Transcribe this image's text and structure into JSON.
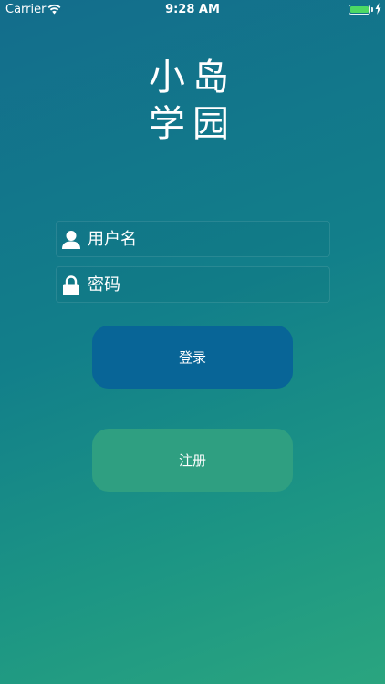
{
  "status_bar": {
    "carrier": "Carrier",
    "time": "9:28 AM",
    "battery_color": "#4cd964"
  },
  "logo": {
    "line1": "小岛",
    "line2": "学园"
  },
  "form": {
    "username": {
      "placeholder": "用户名",
      "value": "",
      "icon": "person-icon"
    },
    "password": {
      "placeholder": "密码",
      "value": "",
      "icon": "lock-icon"
    }
  },
  "buttons": {
    "login_label": "登录",
    "login_color": "#086597",
    "register_label": "注册",
    "register_color": "#2f9f81"
  }
}
